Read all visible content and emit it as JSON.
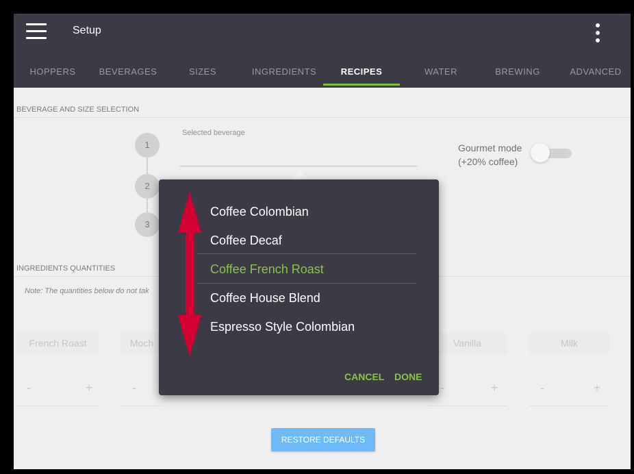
{
  "app": {
    "title": "Setup"
  },
  "tabs": [
    {
      "label": "HOPPERS"
    },
    {
      "label": "BEVERAGES"
    },
    {
      "label": "SIZES"
    },
    {
      "label": "INGREDIENTS"
    },
    {
      "label": "RECIPES"
    },
    {
      "label": "WATER"
    },
    {
      "label": "BREWING"
    },
    {
      "label": "ADVANCED"
    }
  ],
  "active_tab": "RECIPES",
  "beverage_section": {
    "header": "BEVERAGE AND SIZE SELECTION",
    "steps": [
      "1",
      "2",
      "3"
    ],
    "selected_beverage_label": "Selected beverage",
    "gourmet_label_line1": "Gourmet mode",
    "gourmet_label_line2": "(+20% coffee)",
    "gourmet_on": false
  },
  "ingredients_section": {
    "header": "INGREDIENTS QUANTITIES",
    "note": "Note: The quantities below do not tak",
    "ingredients": [
      "French Roast",
      "Moch",
      "Vanilla",
      "Milk"
    ],
    "minus": "-",
    "plus": "+"
  },
  "restore_label": "RESTORE DEFAULTS",
  "dialog": {
    "items": [
      "Coffee Colombian",
      "Coffee Decaf",
      "Coffee French Roast",
      "Coffee House Blend",
      "Espresso Style Colombian"
    ],
    "selected_index": 2,
    "cancel": "CANCEL",
    "done": "DONE"
  },
  "colors": {
    "appbar": "#3c3a45",
    "accent_green": "#8bc34a",
    "button_blue": "#2196f3",
    "arrow_red": "#d50032"
  }
}
